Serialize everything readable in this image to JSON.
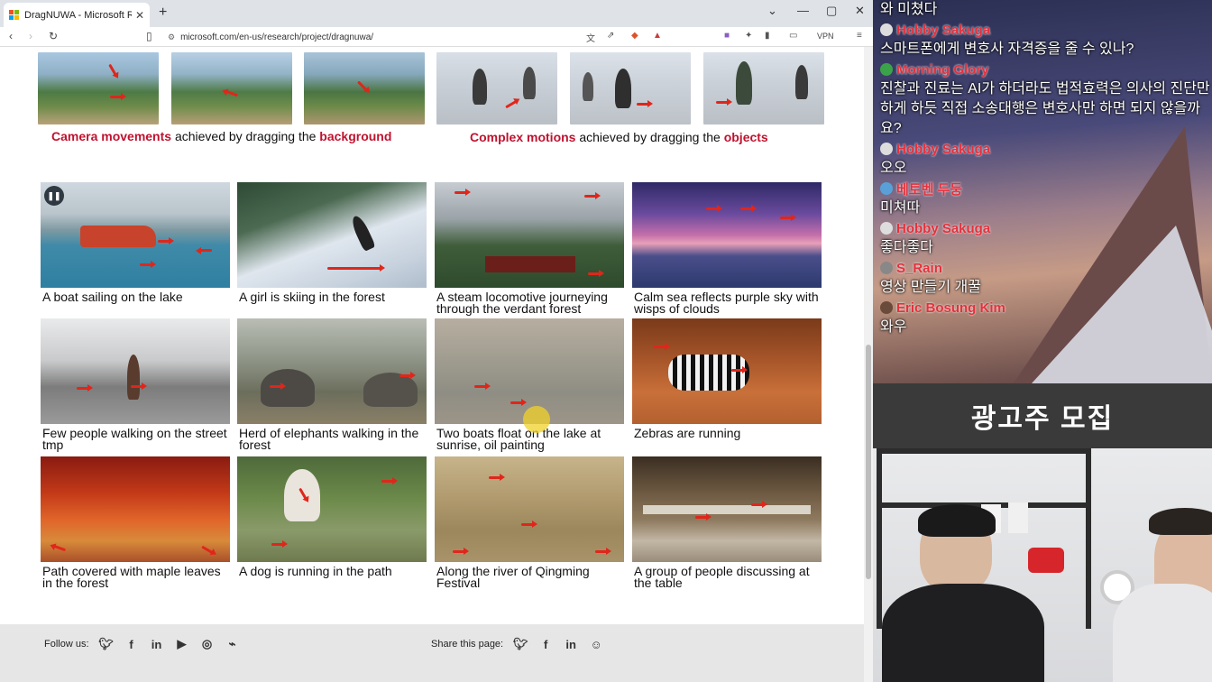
{
  "browser": {
    "tab_title": "DragNUWA - Microsoft Research",
    "tab_close": "✕",
    "new_tab": "+",
    "url": "microsoft.com/en-us/research/project/dragnuwa/",
    "vpn_label": "VPN"
  },
  "top_section": {
    "left_caption": {
      "pre": "Camera movements",
      "mid": " achieved by dragging the ",
      "post": "background"
    },
    "right_caption": {
      "pre": "Complex motions",
      "mid": " achieved by dragging the ",
      "post": "objects"
    }
  },
  "gallery": [
    {
      "caption": "A boat sailing on the lake",
      "has_pause": true
    },
    {
      "caption": "A girl is skiing in the forest"
    },
    {
      "caption": "A steam locomotive journeying through the verdant forest"
    },
    {
      "caption": "Calm sea reflects purple sky with wisps of clouds"
    },
    {
      "caption": "Few people walking on the street tmp"
    },
    {
      "caption": "Herd of elephants walking in the forest"
    },
    {
      "caption": "Two boats float on the lake at sunrise, oil painting"
    },
    {
      "caption": "Zebras are running"
    },
    {
      "caption": "Path covered with maple leaves in the forest"
    },
    {
      "caption": "A dog is running in the path"
    },
    {
      "caption": "Along the river of Qingming Festival"
    },
    {
      "caption": "A group of people discussing at the table"
    }
  ],
  "footer": {
    "follow_label": "Follow us:",
    "share_label": "Share this page:",
    "follow_icons": [
      "twitter-icon",
      "facebook-icon",
      "linkedin-icon",
      "youtube-icon",
      "instagram-icon",
      "rss-icon"
    ],
    "share_icons": [
      "twitter-icon",
      "facebook-icon",
      "linkedin-icon",
      "reddit-icon"
    ]
  },
  "chat": {
    "messages": [
      {
        "name": "",
        "text": "와 미쳤다"
      },
      {
        "name": "Hobby Sakuga",
        "text": "스마트폰에게 변호사 자격증을 줄 수 있나?"
      },
      {
        "name": "Morning Glory",
        "text": "진찰과 진료는 AI가 하더라도 법적효력은 의사의 진단만 하게 하듯 직접 소송대행은 변호사만 하면 되지 않을까요?"
      },
      {
        "name": "Hobby Sakuga",
        "text": "오오"
      },
      {
        "name": "베토벤 두둥",
        "text": "미쳐따"
      },
      {
        "name": "Hobby Sakuga",
        "text": "좋다좋다"
      },
      {
        "name": "S_Rain",
        "text": "영상 만들기 개꿀"
      },
      {
        "name": "Eric Bosung Kim",
        "text": "와우"
      }
    ],
    "ad_banner": "광고주 모집"
  },
  "colors": {
    "accent_red": "#c0122f",
    "arrow_red": "#e0261b",
    "footer_bg": "#e6e6e6"
  }
}
